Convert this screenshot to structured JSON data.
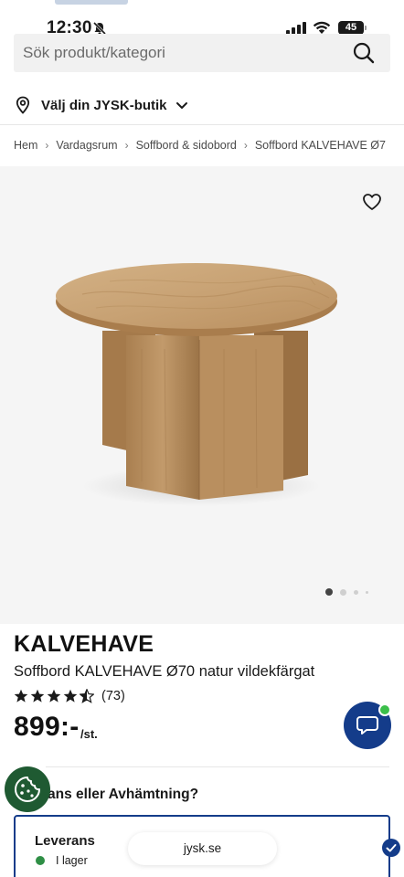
{
  "status_bar": {
    "time": "12:30",
    "battery": "45"
  },
  "search": {
    "placeholder": "Sök produkt/kategori"
  },
  "store": {
    "label": "Välj din JYSK-butik"
  },
  "breadcrumb": [
    "Hem",
    "Vardagsrum",
    "Soffbord & sidobord",
    "Soffbord KALVEHAVE Ø7"
  ],
  "gallery": {
    "image_count": 4,
    "active_index": 0
  },
  "product": {
    "name": "KALVEHAVE",
    "description": "Soffbord KALVEHAVE Ø70 natur vildekfärgat",
    "rating": 4.5,
    "review_count": "(73)",
    "price": "899:-",
    "price_unit": "/st."
  },
  "delivery": {
    "question": "ans eller Avhämtning?",
    "option_title": "Leverans",
    "stock_status": "I lager"
  },
  "browser": {
    "url": "jysk.se"
  },
  "colors": {
    "brand_blue": "#143c8a",
    "online_green": "#3bbf4a",
    "stock_green": "#2f8f46",
    "cookie_green": "#1f5a32"
  }
}
